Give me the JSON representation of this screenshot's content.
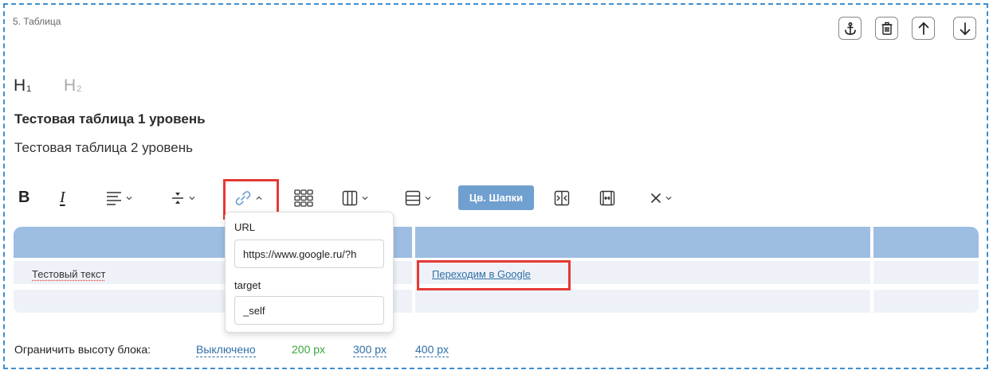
{
  "block": {
    "title": "5. Таблица",
    "controls": [
      "anchor-icon",
      "trash-icon",
      "arrow-up-icon",
      "arrow-down-icon"
    ]
  },
  "headings": {
    "h1_letter": "H",
    "h1_index": "1",
    "h2_letter": "H",
    "h2_index": "2"
  },
  "text": {
    "level1": "Тестовая таблица 1 уровень",
    "level2": "Тестовая таблица 2 уровень"
  },
  "toolbar": {
    "bold": "B",
    "italic": "I",
    "header_color_button": "Цв. Шапки",
    "icons": [
      "bold-icon",
      "italic-icon",
      "align-icon",
      "vertical-align-icon",
      "link-icon",
      "table-grid-icon",
      "columns-icon",
      "rows-icon",
      "merge-cells-icon",
      "split-cells-icon",
      "close-icon"
    ]
  },
  "table": {
    "rows": [
      {
        "col1": "Тестовый текст",
        "col2": "Переходим в Google",
        "col3": ""
      },
      {
        "col1": "",
        "col2": "",
        "col3": ""
      }
    ]
  },
  "link_popup": {
    "url_label": "URL",
    "url_value": "https://www.google.ru/?h",
    "target_label": "target",
    "target_value": "_self"
  },
  "footer": {
    "label": "Ограничить высоту блока:",
    "options": [
      "Выключено",
      "200 px",
      "300 px",
      "400 px"
    ],
    "selected": "200 px"
  },
  "colors": {
    "border": "#3d8fd1",
    "header": "#9dbde3",
    "row": "#eef2f8",
    "accent_button": "#6fa0cf",
    "highlight": "#e53935",
    "link": "#2f6fa7",
    "selected_option": "#3aa63a"
  }
}
